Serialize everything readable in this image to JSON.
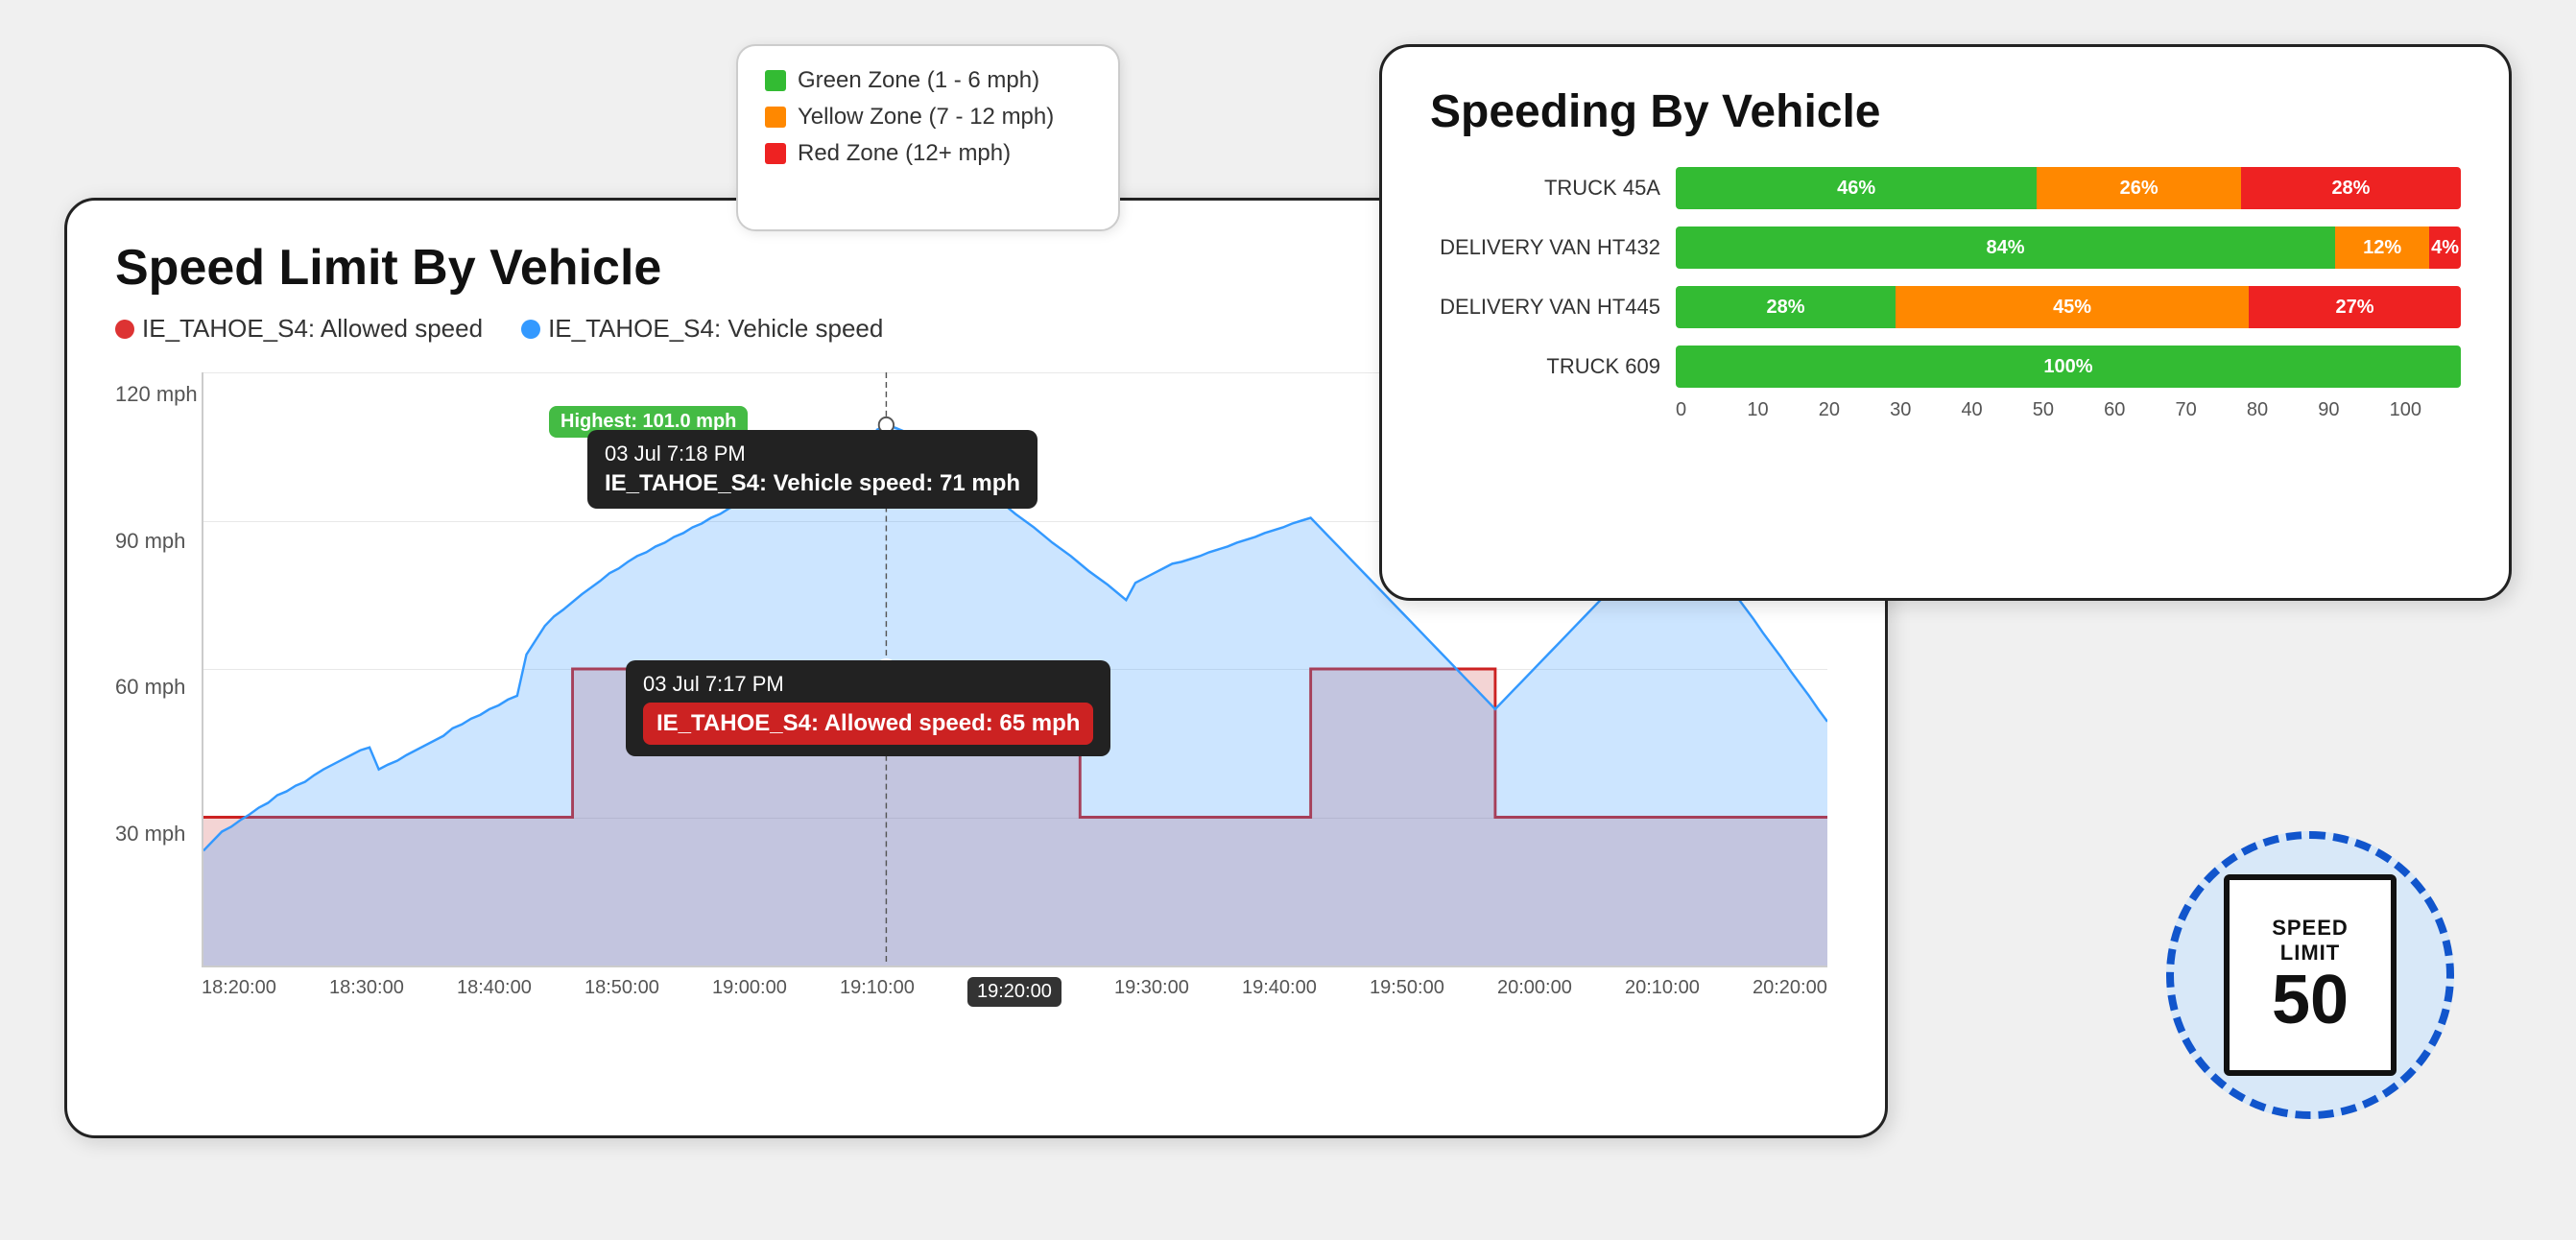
{
  "speed_chart": {
    "title": "Speed Limit By Vehicle",
    "legend": [
      {
        "label": "IE_TAHOE_S4: Allowed speed",
        "color": "#dd3333"
      },
      {
        "label": "IE_TAHOE_S4: Vehicle speed",
        "color": "#3399ff"
      }
    ],
    "y_labels": [
      "120 mph",
      "90 mph",
      "60 mph",
      "30 mph"
    ],
    "x_labels": [
      "18:20:00",
      "18:30:00",
      "18:40:00",
      "18:50:00",
      "19:00:00",
      "19:10:00",
      "19:20:00",
      "19:30:00",
      "19:40:00",
      "19:50:00",
      "20:00:00",
      "20:10:00",
      "20:20:00"
    ],
    "tooltip_time_top": "03 Jul 7:18 PM",
    "tooltip_vehicle_speed": "IE_TAHOE_S4: Vehicle speed:  71 mph",
    "tooltip_time_bottom": "03 Jul 7:17 PM",
    "tooltip_allowed_speed": "IE_TAHOE_S4: Allowed speed:  65 mph",
    "highest_label": "Highest: 101.0 mph",
    "x_tooltip": "03 Jul 7:17 PM"
  },
  "speeding_chart": {
    "title": "Speeding By Vehicle",
    "vehicles": [
      {
        "name": "TRUCK 45A",
        "green": 46,
        "orange": 26,
        "red": 28
      },
      {
        "name": "DELIVERY VAN HT432",
        "green": 84,
        "orange": 12,
        "red": 4
      },
      {
        "name": "DELIVERY VAN HT445",
        "green": 28,
        "orange": 45,
        "red": 27
      },
      {
        "name": "TRUCK 609",
        "green": 100,
        "orange": 0,
        "red": 0
      }
    ],
    "x_ticks": [
      "0",
      "10",
      "20",
      "30",
      "40",
      "50",
      "60",
      "70",
      "80",
      "90",
      "100"
    ]
  },
  "legend_card": {
    "items": [
      {
        "label": "Green Zone (1 - 6 mph)",
        "color": "#33bb33"
      },
      {
        "label": "Yellow Zone (7 - 12 mph)",
        "color": "#ff8800"
      },
      {
        "label": "Red Zone (12+ mph)",
        "color": "#ee2222"
      }
    ]
  },
  "speed_sign": {
    "line1": "SPEED",
    "line2": "LIMIT",
    "number": "50"
  }
}
